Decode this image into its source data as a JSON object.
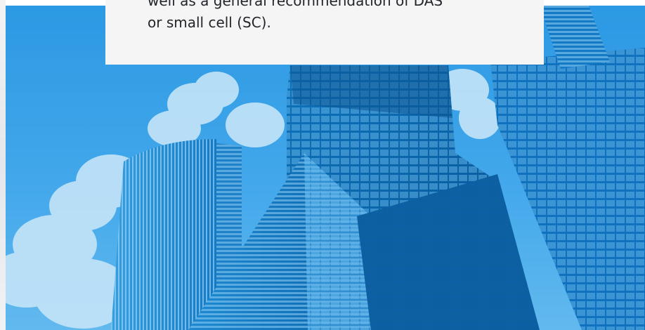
{
  "card": {
    "text": "well as a general recommendation of DAS\nor small cell (SC)."
  },
  "hero": {
    "image_description_icon": "city-skyscrapers-image",
    "sky_color": "#41a6ea",
    "tint_color": "#1689d4"
  }
}
